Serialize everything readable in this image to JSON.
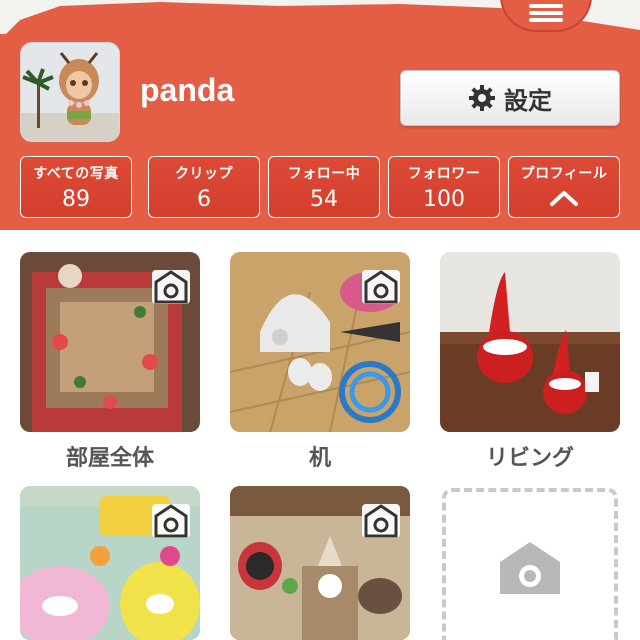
{
  "header": {
    "username": "panda",
    "settings_label": "設定"
  },
  "stats": [
    {
      "label": "すべての写真",
      "value": "89"
    },
    {
      "label": "クリップ",
      "value": "6"
    },
    {
      "label": "フォロー中",
      "value": "54"
    },
    {
      "label": "フォロワー",
      "value": "100"
    },
    {
      "label": "プロフィール",
      "icon": "chevron-up-icon"
    }
  ],
  "gallery": [
    {
      "caption": "部屋全体"
    },
    {
      "caption": "机"
    },
    {
      "caption": "リビング"
    },
    {
      "caption": ""
    },
    {
      "caption": ""
    }
  ],
  "colors": {
    "brand": "#e45e46",
    "stat_bg": "#d43f2d",
    "caption": "#555555"
  }
}
